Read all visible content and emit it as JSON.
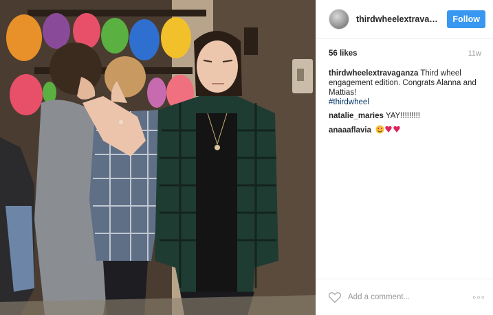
{
  "header": {
    "username": "thirdwheelextravaga...",
    "follow_label": "Follow",
    "avatar_icon": "profile-avatar"
  },
  "meta": {
    "likes": "56 likes",
    "time_ago": "11w"
  },
  "caption": {
    "username": "thirdwheelextravaganza",
    "text": "Third wheel engagement edition. Congrats Alanna and Mattias!",
    "hashtag": "#thirdwheel"
  },
  "comments": [
    {
      "username": "natalie_maries",
      "text": "YAY!!!!!!!!!"
    },
    {
      "username": "anaaaflavia",
      "emoji": "smiling-face-with-heart-eyes, two red hearts"
    }
  ],
  "footer": {
    "like_icon": "heart-outline-icon",
    "add_comment_placeholder": "Add a comment...",
    "more_label": "◦◦◦",
    "more_icon": "more-options-icon"
  },
  "colors": {
    "follow_bg": "#3897f0",
    "hashtag": "#003569",
    "muted": "#999999"
  }
}
